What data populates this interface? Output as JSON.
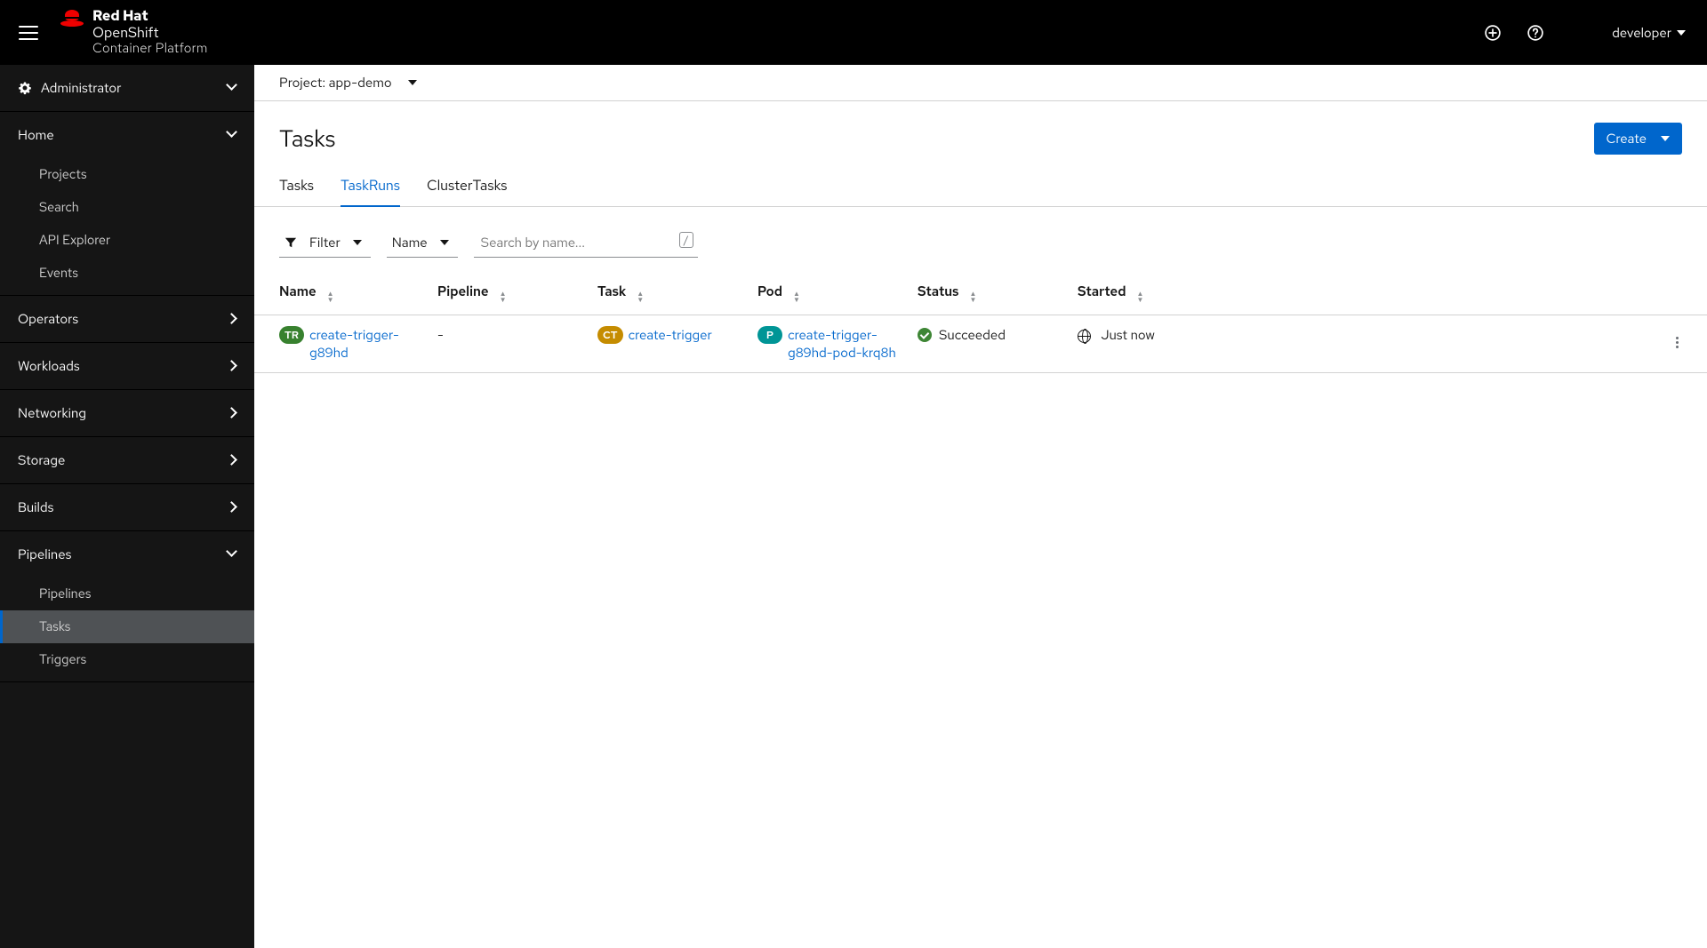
{
  "header": {
    "logo_l1": "Red Hat",
    "logo_l2": "OpenShift",
    "logo_l3": "Container Platform",
    "user": "developer"
  },
  "sidebar": {
    "perspective": "Administrator",
    "sections": [
      {
        "label": "Home",
        "expanded": true,
        "items": [
          "Projects",
          "Search",
          "API Explorer",
          "Events"
        ]
      },
      {
        "label": "Operators",
        "expanded": false
      },
      {
        "label": "Workloads",
        "expanded": false
      },
      {
        "label": "Networking",
        "expanded": false
      },
      {
        "label": "Storage",
        "expanded": false
      },
      {
        "label": "Builds",
        "expanded": false
      },
      {
        "label": "Pipelines",
        "expanded": true,
        "items": [
          "Pipelines",
          "Tasks",
          "Triggers"
        ],
        "active_item": "Tasks"
      }
    ]
  },
  "project_bar": {
    "label": "Project: app-demo"
  },
  "page": {
    "title": "Tasks",
    "create_label": "Create",
    "tabs": [
      "Tasks",
      "TaskRuns",
      "ClusterTasks"
    ],
    "active_tab": "TaskRuns"
  },
  "toolbar": {
    "filter_label": "Filter",
    "scope_label": "Name",
    "search_placeholder": "Search by name...",
    "slash_hint": "/"
  },
  "table": {
    "columns": [
      "Name",
      "Pipeline",
      "Task",
      "Pod",
      "Status",
      "Started"
    ],
    "rows": [
      {
        "name_badge": "TR",
        "name": "create-trigger-g89hd",
        "pipeline": "-",
        "task_badge": "CT",
        "task": "create-trigger",
        "pod_badge": "P",
        "pod": "create-trigger-g89hd-pod-krq8h",
        "status": "Succeeded",
        "started": "Just now"
      }
    ]
  }
}
